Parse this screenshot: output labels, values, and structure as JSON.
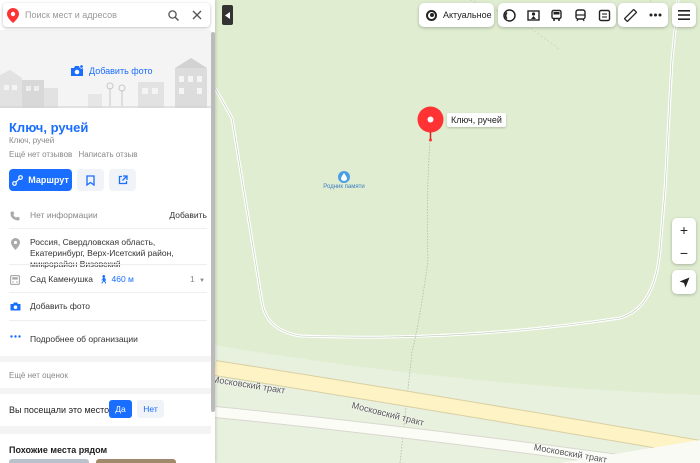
{
  "search": {
    "placeholder": "Поиск мест и адресов"
  },
  "place": {
    "title": "Ключ, ручей",
    "subtitle": "Ключ, ручей",
    "no_reviews": "Ещё нет отзывов",
    "write_review": "Написать отзыв",
    "route_label": "Маршрут",
    "add_photo_header": "Добавить фото"
  },
  "info": {
    "phone_text": "Нет информации",
    "phone_add": "Добавить",
    "address": "Россия, Свердловская область, Екатеринбург, Верх-Исетский район, микрорайон Визовский",
    "transit_stop": "Сад Каменушка",
    "transit_distance": "460 м",
    "transit_count": "1",
    "add_photo": "Добавить фото",
    "more_about": "Подробнее об организации"
  },
  "ratings": {
    "no_ratings": "Ещё нет оценок"
  },
  "visited": {
    "question": "Вы посещали это место?",
    "yes": "Да",
    "no": "Нет"
  },
  "similar": {
    "title": "Похожие места рядом"
  },
  "map": {
    "actual_label": "Актуальное",
    "pin_label": "Ключ, ручей",
    "poi_label": "Родник памяти",
    "road_labels": [
      "Московский тракт",
      "Московский тракт",
      "Московский тракт"
    ],
    "zoom_in": "+",
    "zoom_out": "−"
  },
  "colors": {
    "accent": "#196dff",
    "pin": "#f33",
    "map_bg": "#e0edd1",
    "road": "#fdf3c4"
  },
  "icons": {
    "search_logo": "map-pin-logo-icon",
    "search": "search-icon",
    "close": "close-icon",
    "layers": [
      "traffic-icon",
      "panorama-icon",
      "bus-layer-icon",
      "transport-icon",
      "parking-icon"
    ],
    "tools": [
      "ruler-icon",
      "more-icon"
    ]
  }
}
